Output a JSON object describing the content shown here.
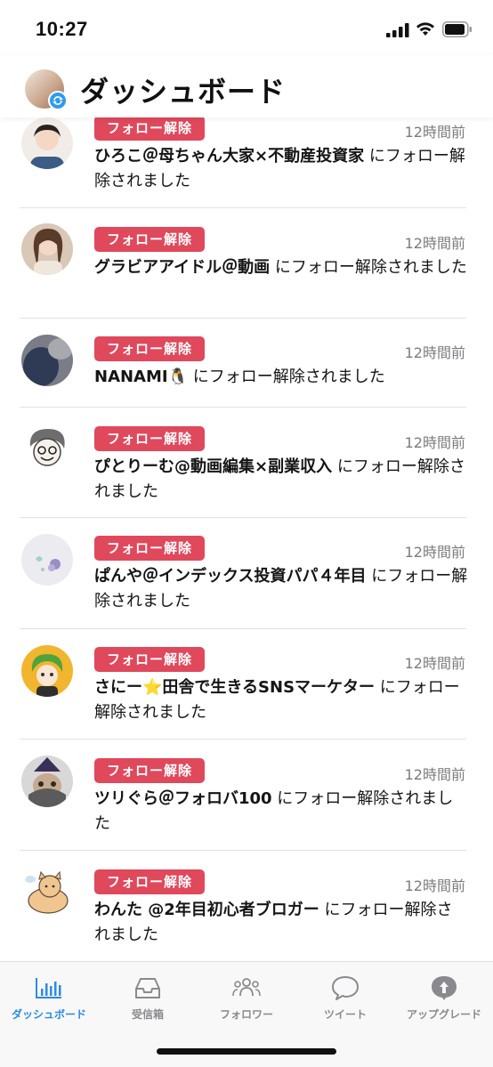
{
  "status_bar": {
    "time": "10:27"
  },
  "header": {
    "title": "ダッシュボード"
  },
  "feed": [
    {
      "badge": "フォロー解除",
      "time": "12時間前",
      "name": "ひろこ＠母ちゃん大家×不動産投資家",
      "suffix": " にフォロー解除されました"
    },
    {
      "badge": "フォロー解除",
      "time": "12時間前",
      "name": "グラビアアイドル＠動画",
      "suffix": " にフォロー解除されました"
    },
    {
      "badge": "フォロー解除",
      "time": "12時間前",
      "name": "NANAMI🐧",
      "suffix": " にフォロー解除されました"
    },
    {
      "badge": "フォロー解除",
      "time": "12時間前",
      "name": "ぴとりーむ@動画編集×副業収入",
      "suffix": " にフォロー解除されました"
    },
    {
      "badge": "フォロー解除",
      "time": "12時間前",
      "name": "ぱんや＠インデックス投資パパ４年目",
      "suffix": " にフォロー解除されました"
    },
    {
      "badge": "フォロー解除",
      "time": "12時間前",
      "name": "さにー⭐田舎で生きるSNSマーケター",
      "suffix": " にフォロー解除されました"
    },
    {
      "badge": "フォロー解除",
      "time": "12時間前",
      "name": "ツリぐら＠フォロバ100",
      "suffix": " にフォロー解除されました"
    },
    {
      "badge": "フォロー解除",
      "time": "12時間前",
      "name": "わんた @2年目初心者ブロガー",
      "suffix": " にフォロー解除されました"
    }
  ],
  "tabbar": {
    "items": [
      {
        "label": "ダッシュボード",
        "icon": "bar-chart-icon",
        "active": true
      },
      {
        "label": "受信箱",
        "icon": "inbox-icon",
        "active": false
      },
      {
        "label": "フォロワー",
        "icon": "people-icon",
        "active": false
      },
      {
        "label": "ツイート",
        "icon": "speech-bubble-icon",
        "active": false
      },
      {
        "label": "アップグレード",
        "icon": "upgrade-icon",
        "active": false
      }
    ]
  },
  "colors": {
    "badge": "#e0485c",
    "active_tab": "#2b8be6",
    "inactive_tab": "#8a8a8e"
  }
}
